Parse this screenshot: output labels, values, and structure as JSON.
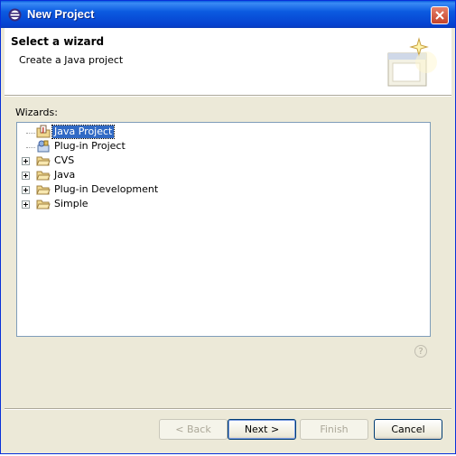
{
  "window": {
    "title": "New Project"
  },
  "header": {
    "title": "Select a wizard",
    "description": "Create a Java project"
  },
  "wizards": {
    "label": "Wizards:",
    "items": [
      {
        "label": "Java Project",
        "icon": "java-project-icon",
        "selected": true
      },
      {
        "label": "Plug-in Project",
        "icon": "plugin-project-icon"
      },
      {
        "label": "CVS",
        "icon": "folder-icon"
      },
      {
        "label": "Java",
        "icon": "folder-icon"
      },
      {
        "label": "Plug-in Development",
        "icon": "folder-icon"
      },
      {
        "label": "Simple",
        "icon": "folder-icon"
      }
    ]
  },
  "help": {
    "symbol": "?"
  },
  "buttons": {
    "back": "< Back",
    "next": "Next >",
    "finish": "Finish",
    "cancel": "Cancel"
  },
  "colors": {
    "titlebar": "#0a5fe0",
    "selection": "#316ac5",
    "dialog_bg": "#ece9d8"
  }
}
